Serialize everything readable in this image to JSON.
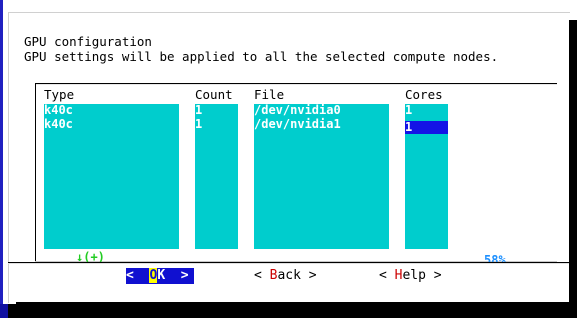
{
  "dialog": {
    "title": "GPU configuration",
    "subtitle": "GPU settings will be applied to all the selected compute nodes."
  },
  "columns": {
    "type": {
      "header": "Type",
      "rows": [
        "k40c",
        "k40c"
      ]
    },
    "count": {
      "header": "Count",
      "rows": [
        "1",
        "1"
      ]
    },
    "file": {
      "header": "File",
      "rows": [
        "/dev/nvidia0",
        "/dev/nvidia1"
      ]
    },
    "cores": {
      "header": "Cores",
      "rows": [
        "1",
        "1"
      ]
    }
  },
  "scroll_indicator": "↓(+)",
  "scroll_percent": "58%",
  "buttons": {
    "ok": {
      "left": "<",
      "hot": "O",
      "rest": "K",
      "right": ">"
    },
    "back": {
      "left": "< ",
      "hot": "B",
      "rest": "ack",
      "right": " >"
    },
    "help": {
      "left": "< ",
      "hot": "H",
      "rest": "elp",
      "right": " >"
    }
  },
  "colors": {
    "column_bg": "#00cdcd",
    "selection_bg": "#1414e6",
    "scroll_indicator": "#22cc22",
    "percent": "#1e90ff",
    "hotkey": "#cc0000"
  }
}
